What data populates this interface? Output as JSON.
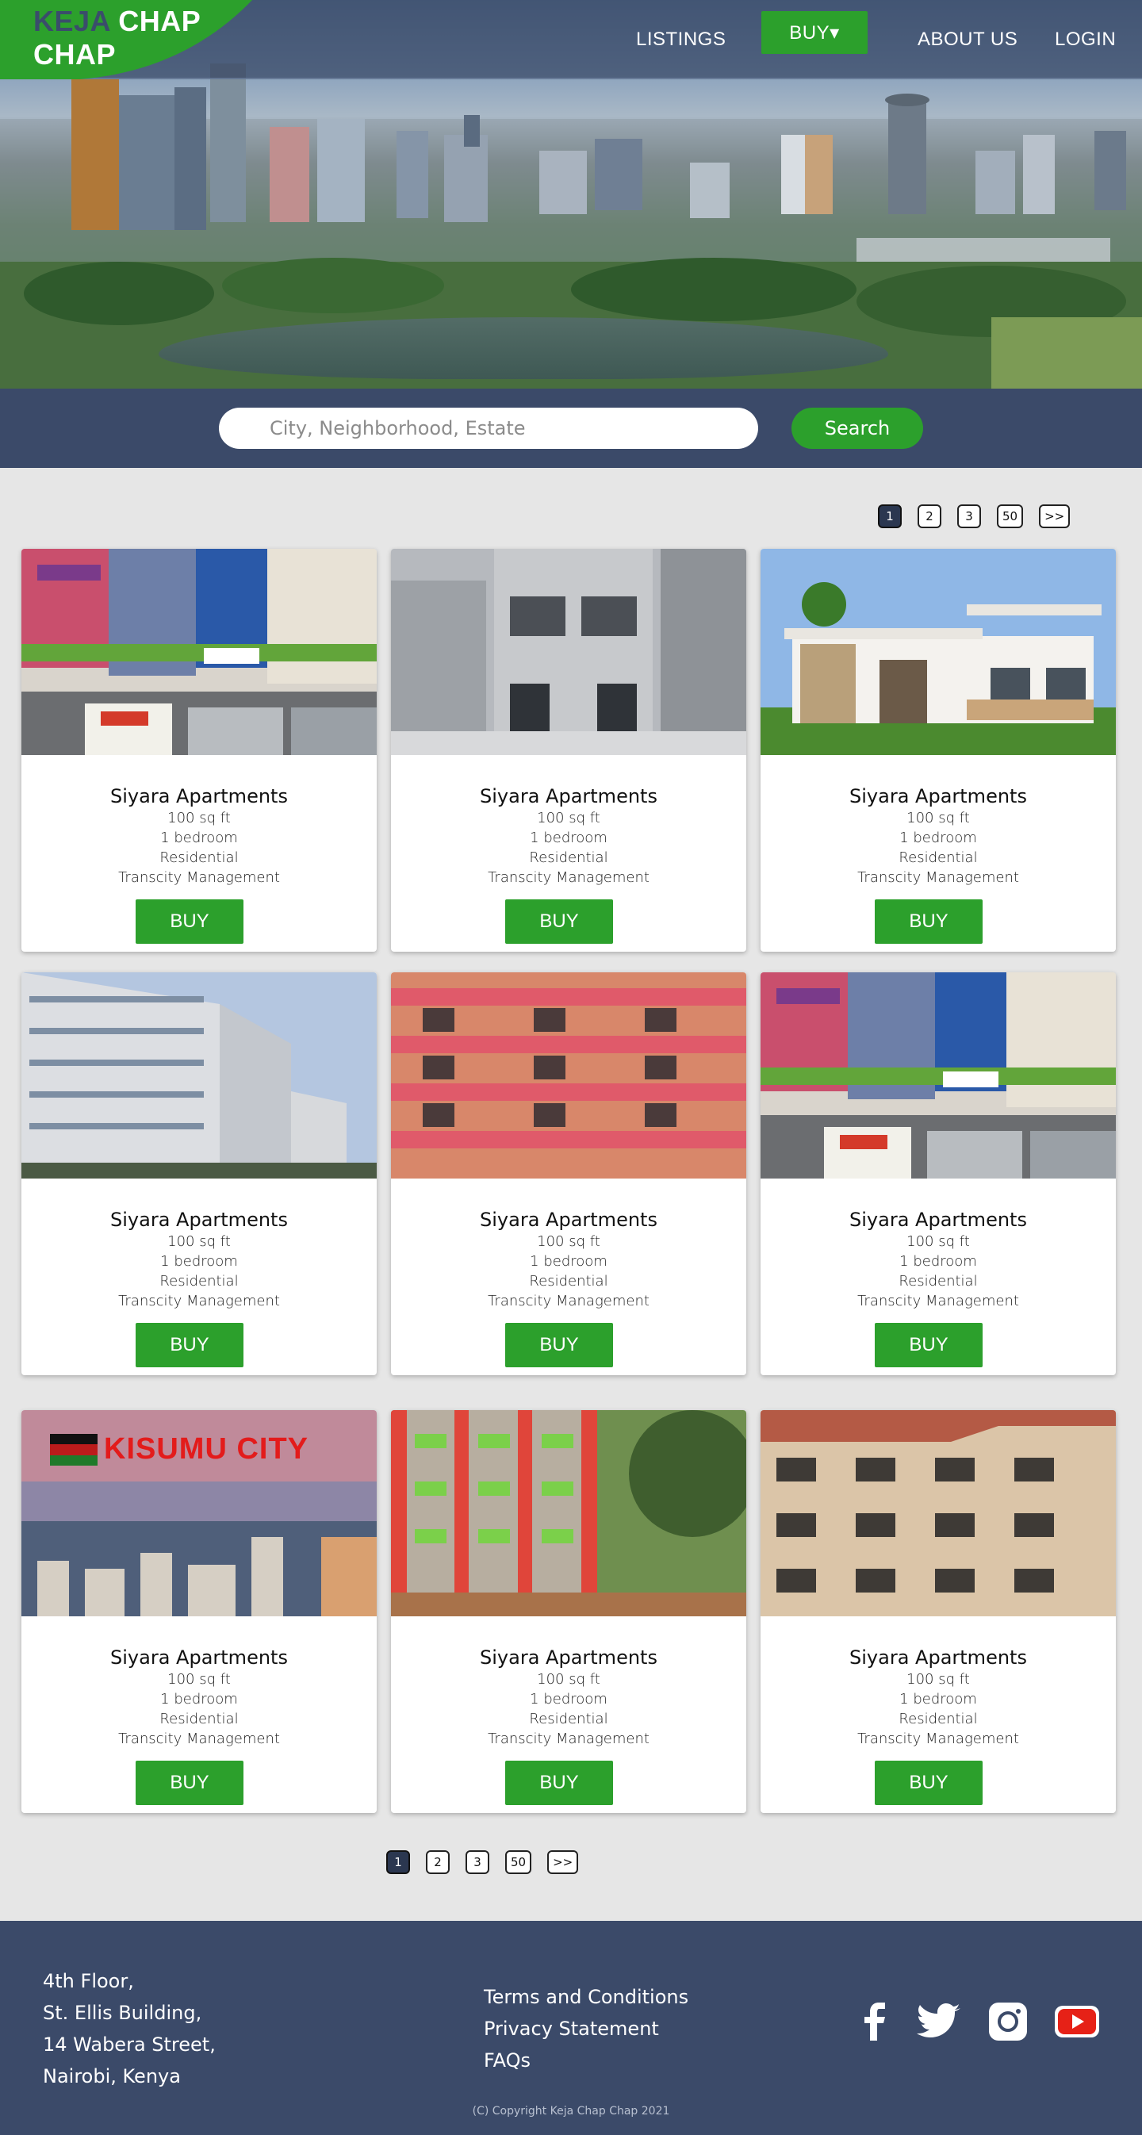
{
  "brand": {
    "word1": "KEJA",
    "word2": "CHAP",
    "word3": "CHAP"
  },
  "nav": {
    "listings": "LISTINGS",
    "buy": "BUY▾",
    "about": "ABOUT US",
    "login": "LOGIN"
  },
  "search": {
    "placeholder": "City, Neighborhood, Estate",
    "button": "Search"
  },
  "pagination": {
    "pages": [
      "1",
      "2",
      "3",
      "50",
      ">>"
    ],
    "active": "1"
  },
  "listings": [
    {
      "title": "Siyara Apartments",
      "area": "100 sq ft",
      "bedrooms": "1 bedroom",
      "type": "Residential",
      "manager": "Transcity Management",
      "buy": "BUY",
      "photo": "street-building"
    },
    {
      "title": "Siyara Apartments",
      "area": "100 sq ft",
      "bedrooms": "1 bedroom",
      "type": "Residential",
      "manager": "Transcity Management",
      "buy": "BUY",
      "photo": "grey-apartment"
    },
    {
      "title": "Siyara Apartments",
      "area": "100 sq ft",
      "bedrooms": "1 bedroom",
      "type": "Residential",
      "manager": "Transcity Management",
      "buy": "BUY",
      "photo": "white-house"
    },
    {
      "title": "Siyara Apartments",
      "area": "100 sq ft",
      "bedrooms": "1 bedroom",
      "type": "Residential",
      "manager": "Transcity Management",
      "buy": "BUY",
      "photo": "modern-block"
    },
    {
      "title": "Siyara Apartments",
      "area": "100 sq ft",
      "bedrooms": "1 bedroom",
      "type": "Residential",
      "manager": "Transcity Management",
      "buy": "BUY",
      "photo": "pink-balconies"
    },
    {
      "title": "Siyara Apartments",
      "area": "100 sq ft",
      "bedrooms": "1 bedroom",
      "type": "Residential",
      "manager": "Transcity Management",
      "buy": "BUY",
      "photo": "street-building"
    },
    {
      "title": "Siyara Apartments",
      "area": "100 sq ft",
      "bedrooms": "1 bedroom",
      "type": "Residential",
      "manager": "Transcity Management",
      "buy": "BUY",
      "photo": "kisumu-city",
      "photo_caption": "KISUMU CITY"
    },
    {
      "title": "Siyara Apartments",
      "area": "100 sq ft",
      "bedrooms": "1 bedroom",
      "type": "Residential",
      "manager": "Transcity Management",
      "buy": "BUY",
      "photo": "red-green-apartment"
    },
    {
      "title": "Siyara Apartments",
      "area": "100 sq ft",
      "bedrooms": "1 bedroom",
      "type": "Residential",
      "manager": "Transcity Management",
      "buy": "BUY",
      "photo": "beige-townhouses"
    }
  ],
  "footer": {
    "address": [
      "4th Floor,",
      "St. Ellis Building,",
      "14 Wabera Street,",
      "Nairobi, Kenya"
    ],
    "links": [
      "Terms and Conditions",
      "Privacy Statement",
      "FAQs"
    ],
    "social": [
      "facebook-icon",
      "twitter-icon",
      "instagram-icon",
      "youtube-icon"
    ],
    "copyright": "(C) Copyright Keja Chap Chap  2021"
  },
  "colors": {
    "brand_green": "#2ca02c",
    "navy": "#3b4a69",
    "page_bg": "#e6e6e6",
    "youtube_red": "#e62117"
  }
}
